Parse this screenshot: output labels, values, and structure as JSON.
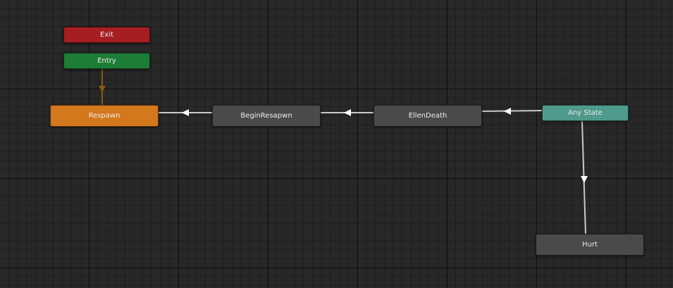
{
  "graph": {
    "nodes": {
      "exit": "Exit",
      "entry": "Entry",
      "respawn": "Respawn",
      "begin_respawn": "BeginResapwn",
      "ellen_death": "EllenDeath",
      "any_state": "Any State",
      "hurt": "Hurt"
    }
  },
  "colors": {
    "background": "#282828",
    "exit_node": "#a71e22",
    "entry_node": "#1d7d36",
    "default_state": "#d3781c",
    "state_node": "#4a4a4d",
    "any_state_node": "#4e9a8c",
    "transition": "#c8c8c8",
    "entry_transition": "#8a5a12"
  }
}
